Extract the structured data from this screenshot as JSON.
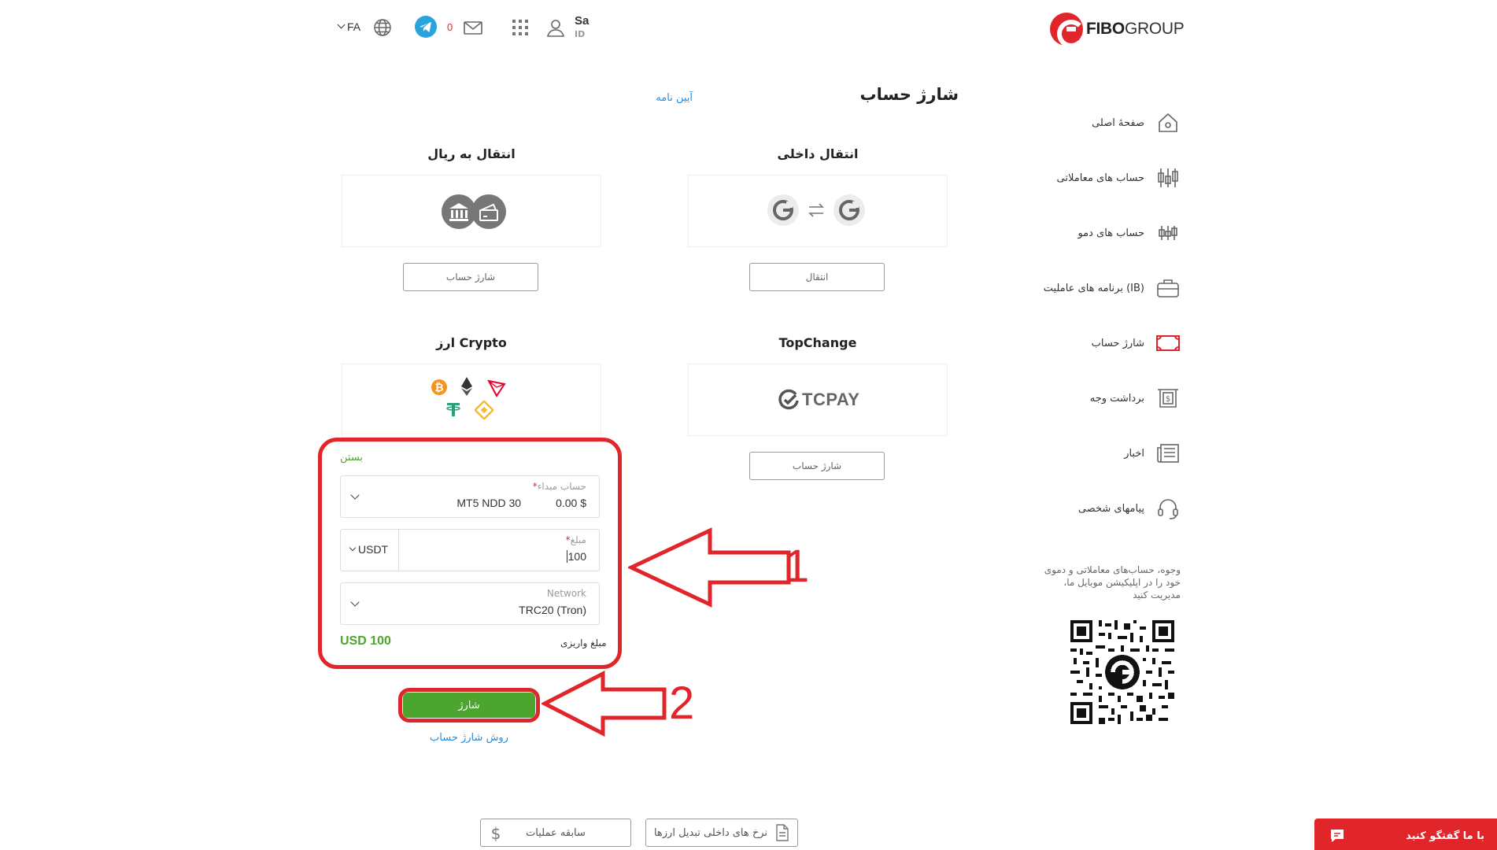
{
  "brand": {
    "name_bold": "FIBO",
    "name_regular": "GROUP"
  },
  "header": {
    "user_name": "Sa",
    "user_id_label": "ID",
    "mail_count": "0",
    "language": "FA"
  },
  "sidebar": {
    "items": [
      {
        "label": "صفحهٔ اصلی",
        "icon": "home-icon"
      },
      {
        "label": "حساب های معاملاتی",
        "icon": "candlestick-icon"
      },
      {
        "label": "حساب های دمو",
        "icon": "candlestick-small-icon"
      },
      {
        "label": "برنامه های عاملیت (IB)",
        "icon": "briefcase-icon"
      },
      {
        "label": "شارژ حساب",
        "icon": "deposit-icon",
        "active": true
      },
      {
        "label": "برداشت وجه",
        "icon": "withdraw-icon"
      },
      {
        "label": "اخبار",
        "icon": "news-icon"
      },
      {
        "label": "پیامهای شخصی",
        "icon": "headset-icon"
      }
    ],
    "promo": "وجوه، حساب‌های معاملاتی و دموی خود را در اپلیکیشن موبایل ما، مدیریت کنید"
  },
  "main": {
    "title": "شارژ حساب",
    "rules_link": "آیین نامه",
    "cards": {
      "internal": {
        "title": "انتقال داخلی",
        "button": "انتقال"
      },
      "rial": {
        "title": "انتقال به ریال",
        "button": "شارژ حساب"
      },
      "topchange": {
        "title": "TopChange",
        "logo_text": "TCPAY",
        "button": "شارژ حساب"
      },
      "crypto": {
        "title": "ارز Crypto"
      }
    },
    "form": {
      "close_label": "بستن",
      "source_account": {
        "label": "حساب مبداء",
        "balance": "0.00 $",
        "account": "MT5 NDD 30"
      },
      "amount": {
        "label": "مبلغ",
        "value": "100",
        "currency": "USDT"
      },
      "network": {
        "label": "Network",
        "value": "TRC20 (Tron)"
      },
      "deposit_amount": {
        "label": "مبلغ واریزی",
        "value": "USD 100"
      },
      "submit": "شارژ",
      "method_link": "روش شارژ حساب"
    },
    "annotations": {
      "step1": "1",
      "step2": "2"
    }
  },
  "footer": {
    "history_button": "سابقه عملیات",
    "rates_button": "نرخ های داخلی تبدیل ارزها",
    "chat_button": "با ما گفتگو کنید"
  },
  "colors": {
    "brand_red": "#e0262b",
    "success_green": "#4ca52f",
    "link_blue": "#2a8cd8"
  }
}
